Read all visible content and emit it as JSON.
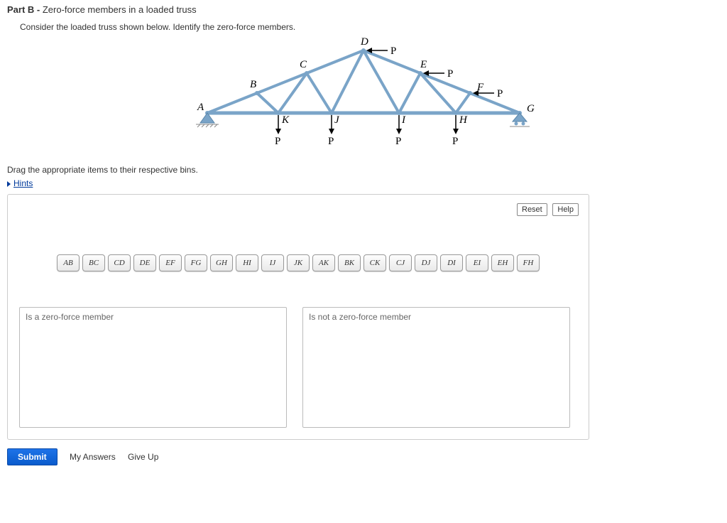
{
  "part": {
    "label": "Part B",
    "title": "Zero-force members in a loaded truss"
  },
  "prompt": "Consider the loaded truss shown below. Identify the zero-force members.",
  "instruction": "Drag the appropriate items to their respective bins.",
  "hints_label": "Hints",
  "buttons": {
    "reset": "Reset",
    "help": "Help",
    "submit": "Submit",
    "my_answers": "My Answers",
    "give_up": "Give Up"
  },
  "chips": [
    "AB",
    "BC",
    "CD",
    "DE",
    "EF",
    "FG",
    "GH",
    "HI",
    "IJ",
    "JK",
    "AK",
    "BK",
    "CK",
    "CJ",
    "DJ",
    "DI",
    "EI",
    "EH",
    "FH"
  ],
  "bins": {
    "zero": "Is a zero-force member",
    "notzero": "Is not a zero-force member"
  },
  "truss": {
    "node_labels": [
      "A",
      "B",
      "C",
      "D",
      "E",
      "F",
      "G",
      "H",
      "I",
      "J",
      "K"
    ],
    "load_label": "P"
  }
}
